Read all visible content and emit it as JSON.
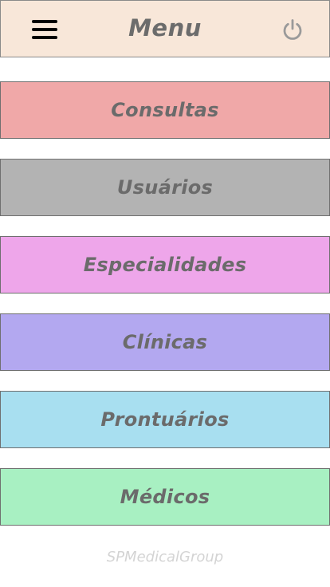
{
  "header": {
    "title": "Menu"
  },
  "menu": {
    "items": [
      {
        "label": "Consultas",
        "color": "#f0a8a8"
      },
      {
        "label": "Usuários",
        "color": "#b3b3b3"
      },
      {
        "label": "Especialidades",
        "color": "#eea6ea"
      },
      {
        "label": "Clínicas",
        "color": "#b3a8f0"
      },
      {
        "label": "Prontuários",
        "color": "#a8dff0"
      },
      {
        "label": "Médicos",
        "color": "#a8f0c2"
      }
    ]
  },
  "footer": {
    "text": "SPMedicalGroup"
  },
  "colors": {
    "header_bg": "#f8e7d9",
    "title_text": "#6c6c6c",
    "footer_text": "#d4d4d4"
  },
  "icons": {
    "menu": "hamburger-icon",
    "logout": "power-icon"
  }
}
